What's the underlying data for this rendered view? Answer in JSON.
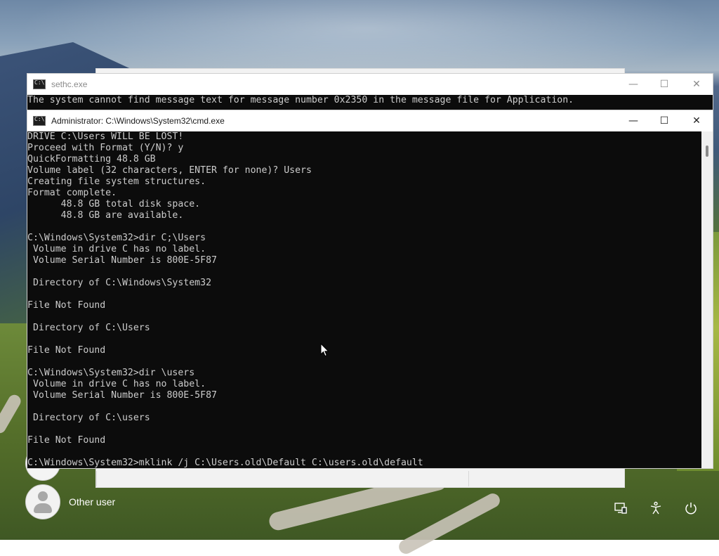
{
  "windows": {
    "sethc": {
      "title": "sethc.exe",
      "message": "The system cannot find message text for message number 0x2350 in the message file for Application."
    },
    "cmd": {
      "title": "Administrator: C:\\Windows\\System32\\cmd.exe",
      "lines": [
        "DRIVE C:\\Users WILL BE LOST!",
        "Proceed with Format (Y/N)? y",
        "QuickFormatting 48.8 GB",
        "Volume label (32 characters, ENTER for none)? Users",
        "Creating file system structures.",
        "Format complete.",
        "      48.8 GB total disk space.",
        "      48.8 GB are available.",
        "",
        "C:\\Windows\\System32>dir C;\\Users",
        " Volume in drive C has no label.",
        " Volume Serial Number is 800E-5F87",
        "",
        " Directory of C:\\Windows\\System32",
        "",
        "File Not Found",
        "",
        " Directory of C:\\Users",
        "",
        "File Not Found",
        "",
        "C:\\Windows\\System32>dir \\users",
        " Volume in drive C has no label.",
        " Volume Serial Number is 800E-5F87",
        "",
        " Directory of C:\\users",
        "",
        "File Not Found",
        "",
        "C:\\Windows\\System32>mklink /j C:\\Users.old\\Default C:\\users.old\\default"
      ]
    }
  },
  "window_controls": {
    "minimize": "—",
    "maximize": "☐",
    "close": "✕"
  },
  "login": {
    "other_user_label": "Other user"
  },
  "system_icons": [
    "network-icon",
    "accessibility-icon",
    "power-icon"
  ]
}
